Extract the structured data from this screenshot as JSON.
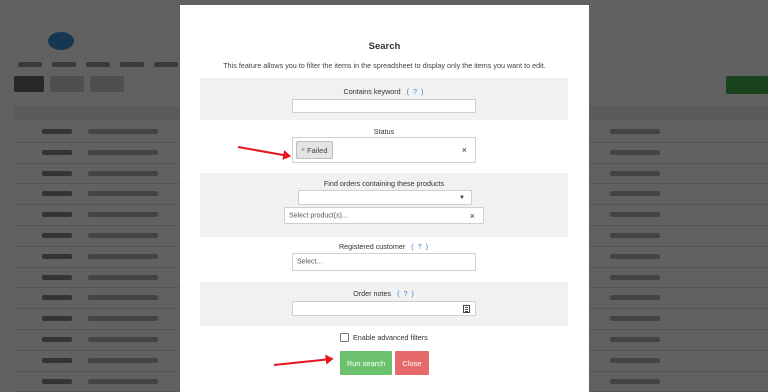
{
  "modal": {
    "title": "Search",
    "description": "This feature allows you to filter the items in the spreadsheet to display only the items you want to edit.",
    "keyword": {
      "label": "Contains keyword",
      "help": "( ? )",
      "value": ""
    },
    "status": {
      "label": "Status",
      "selected_tag": "Failed",
      "tag_remove": "×",
      "clear": "×"
    },
    "products": {
      "label": "Find orders containing these products",
      "dropdown_value": "",
      "caret": "▼",
      "placeholder": "Select product(s)...",
      "clear": "×"
    },
    "customer": {
      "label": "Registered customer",
      "help": "( ? )",
      "placeholder": "Select..."
    },
    "notes": {
      "label": "Order notes",
      "help": "( ? )",
      "value": ""
    },
    "advanced": {
      "label": "Enable advanced filters",
      "checked": false
    },
    "buttons": {
      "run": "Run search",
      "close": "Close"
    }
  },
  "colors": {
    "accent_link": "#2c7fd0",
    "run_button": "#6cc26c",
    "close_button": "#e66a6a",
    "annotation_arrow": "#e8161c",
    "overlay": "rgba(0,0,0,0.62)"
  }
}
